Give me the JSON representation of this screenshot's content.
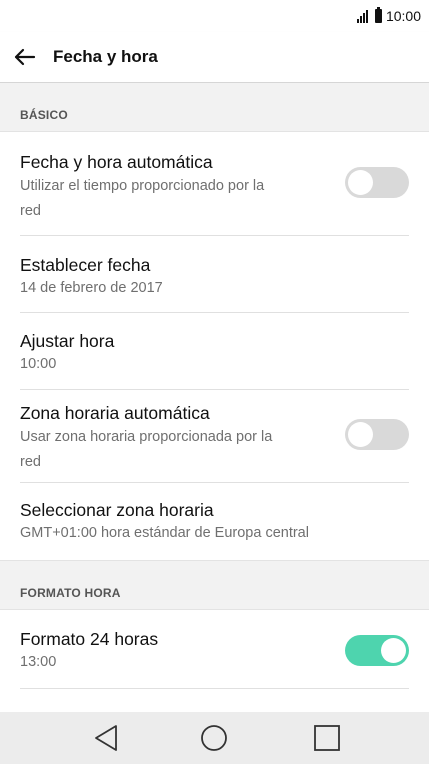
{
  "status_bar": {
    "time": "10:00"
  },
  "header": {
    "title": "Fecha y hora"
  },
  "sections": {
    "basic": {
      "label": "BÁSICO"
    },
    "format": {
      "label": "FORMATO HORA"
    }
  },
  "settings": {
    "auto_datetime": {
      "title": "Fecha y hora automática",
      "subtitle_line1": "Utilizar el tiempo proporcionado por la",
      "subtitle_line2": "red",
      "enabled": false
    },
    "set_date": {
      "title": "Establecer fecha",
      "value": "14 de febrero de 2017"
    },
    "set_time": {
      "title": "Ajustar hora",
      "value": "10:00"
    },
    "auto_timezone": {
      "title": "Zona horaria automática",
      "subtitle_line1": "Usar zona horaria proporcionada por la",
      "subtitle_line2": "red",
      "enabled": false
    },
    "select_timezone": {
      "title": "Seleccionar zona horaria",
      "value": "GMT+01:00 hora estándar de Europa central"
    },
    "format_24h": {
      "title": "Formato 24 horas",
      "value": "13:00",
      "enabled": true
    }
  },
  "colors": {
    "toggle_on": "#4ed4ae",
    "toggle_off": "#d9d9d9",
    "section_bg": "#f2f2f2",
    "nav_bg": "#ececec"
  },
  "navigation": {
    "icons": [
      "back-triangle-icon",
      "home-circle-icon",
      "recents-square-icon"
    ]
  }
}
